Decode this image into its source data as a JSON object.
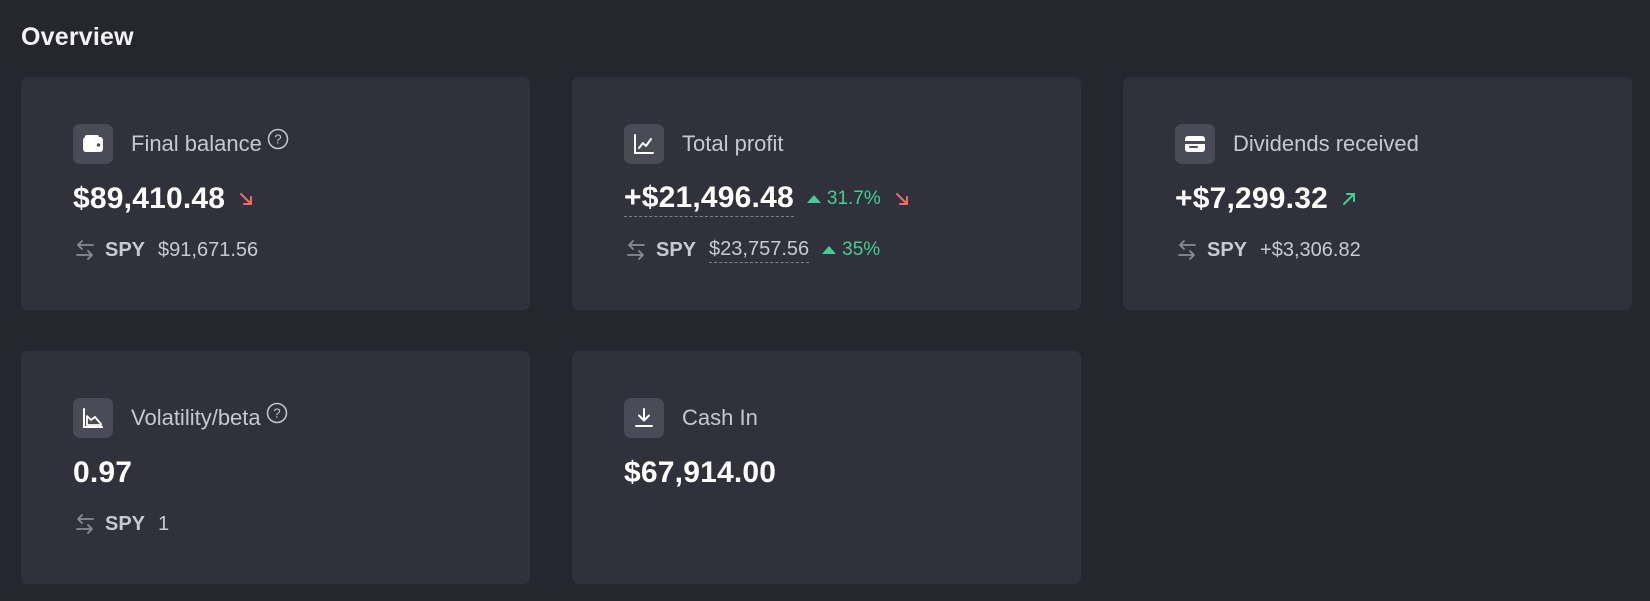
{
  "section_title": "Overview",
  "cards": [
    {
      "title": "Final balance",
      "icon": "wallet-icon",
      "has_help": true,
      "value": "$89,410.48",
      "trend": "down",
      "compare_label": "SPY",
      "compare_value": "$91,671.56"
    },
    {
      "title": "Total profit",
      "icon": "line-chart-icon",
      "value": "+$21,496.48",
      "value_change": "31.7%",
      "trend": "down",
      "compare_label": "SPY",
      "compare_value": "$23,757.56",
      "compare_change": "35%"
    },
    {
      "title": "Dividends received",
      "icon": "card-icon",
      "value": "+$7,299.32",
      "trend": "up",
      "compare_label": "SPY",
      "compare_value": "+$3,306.82"
    },
    {
      "title": "Volatility/beta",
      "icon": "area-chart-icon",
      "has_help": true,
      "value": "0.97",
      "compare_label": "SPY",
      "compare_value": "1"
    },
    {
      "title": "Cash In",
      "icon": "download-icon",
      "value": "$67,914.00"
    }
  ],
  "colors": {
    "background": "#26262f",
    "card": "#31313c",
    "positive": "#3fd193",
    "negative": "#ef6f5e",
    "trend_up": "#3fd193"
  }
}
